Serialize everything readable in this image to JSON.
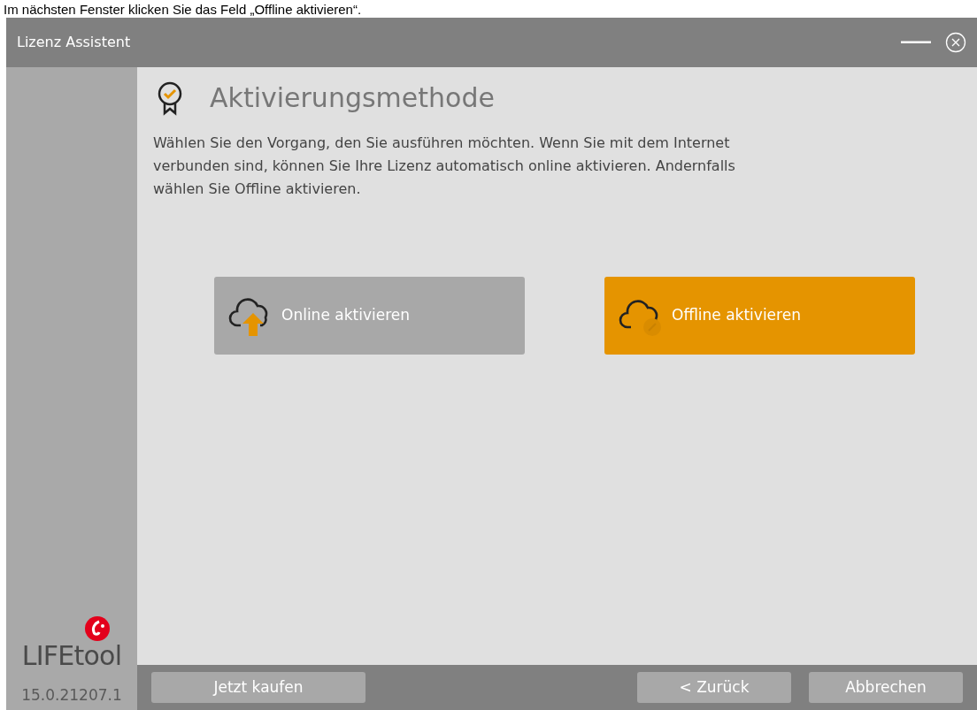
{
  "caption": "Im nächsten Fenster klicken Sie das Feld „Offline aktivieren“.",
  "window": {
    "title": "Lizenz Assistent"
  },
  "page": {
    "heading": "Aktivierungsmethode",
    "description": "Wählen Sie den Vorgang, den Sie ausführen möchten. Wenn Sie mit dem Internet verbunden sind, können Sie Ihre Lizenz automatisch online aktivieren. Andernfalls wählen Sie Offline aktivieren."
  },
  "options": [
    {
      "kind": "online",
      "label": "Online aktivieren",
      "selected": false
    },
    {
      "kind": "offline",
      "label": "Offline aktivieren",
      "selected": true
    }
  ],
  "sidebar": {
    "logo_text": "LIFEtool",
    "version": "15.0.21207.1"
  },
  "footer": {
    "left_buttons": [
      "Jetzt kaufen"
    ],
    "right_buttons": [
      "< Zurück",
      "Abbrechen"
    ]
  }
}
